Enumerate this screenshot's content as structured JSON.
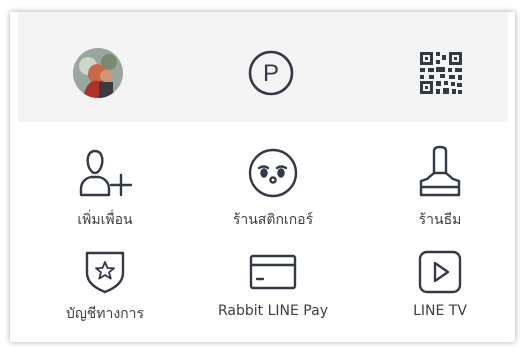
{
  "top_actions": [
    {
      "name": "profile",
      "icon": "profile-photo"
    },
    {
      "name": "points",
      "icon": "p-circle-icon",
      "glyph": "P"
    },
    {
      "name": "qr-code",
      "icon": "qr-code-icon"
    }
  ],
  "menu": {
    "add_friend": {
      "label": "เพิ่มเพื่อน",
      "icon": "add-friend-icon"
    },
    "sticker_shop": {
      "label": "ร้านสติกเกอร์",
      "icon": "sticker-face-icon"
    },
    "theme_shop": {
      "label": "ร้านธีม",
      "icon": "brush-icon"
    },
    "official_accounts": {
      "label": "บัญชีทางการ",
      "icon": "shield-star-icon"
    },
    "rabbit_line_pay": {
      "label": "Rabbit LINE Pay",
      "icon": "card-icon"
    },
    "line_tv": {
      "label": "LINE TV",
      "icon": "play-icon"
    }
  },
  "colors": {
    "icon": "#333a45",
    "topbar_bg": "#f4f4f5"
  }
}
